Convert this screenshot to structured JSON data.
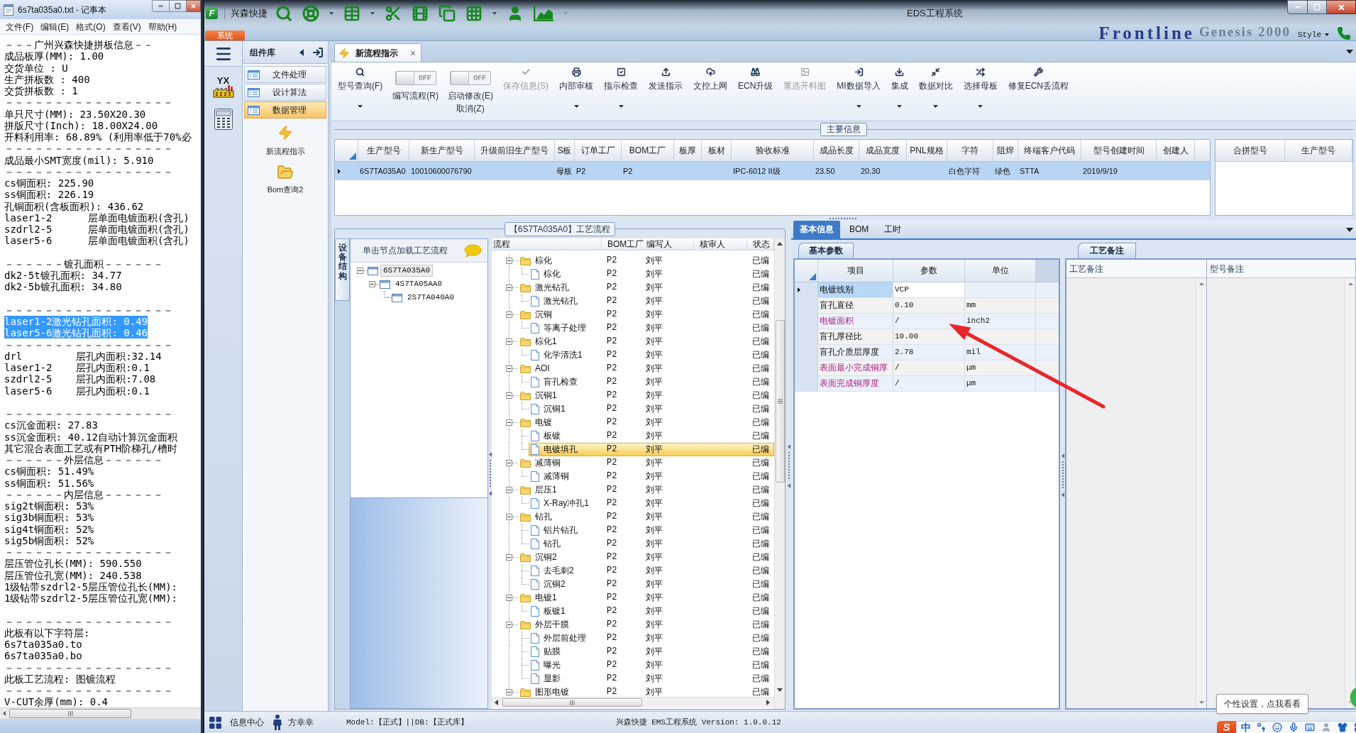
{
  "notepad": {
    "title": "6s7ta035a0.txt - 记事本",
    "menu": [
      "文件(F)",
      "编辑(E)",
      "格式(O)",
      "查看(V)",
      "帮助(H)"
    ],
    "lines": [
      {
        "kind": "text",
        "text": "－－－广州兴森快捷拼板信息－－",
        "selected": false
      },
      {
        "kind": "text",
        "text": "成品板厚(MM): 1.00",
        "selected": false
      },
      {
        "kind": "text",
        "text": "交货单位 : U",
        "selected": false
      },
      {
        "kind": "text",
        "text": "生产拼板数 : 400",
        "selected": false
      },
      {
        "kind": "text",
        "text": "交货拼板数 : 1",
        "selected": false
      },
      {
        "kind": "text",
        "text": "－－－－－－－－－－－－－－－－－",
        "selected": false
      },
      {
        "kind": "text",
        "text": "单只尺寸(MM): 23.50X20.30",
        "selected": false
      },
      {
        "kind": "text",
        "text": "拼版尺寸(Inch): 18.00X24.00",
        "selected": false
      },
      {
        "kind": "text",
        "text": "开料利用率: 68.89% (利用率低于70%必",
        "selected": false
      },
      {
        "kind": "text",
        "text": "－－－－－－－－－－－－－－－－－",
        "selected": false
      },
      {
        "kind": "text",
        "text": "成品最小SMT宽度(mil): 5.910",
        "selected": false
      },
      {
        "kind": "text",
        "text": "－－－－－－－－－－－－－－－－－",
        "selected": false
      },
      {
        "kind": "text",
        "text": "cs铜面积: 225.90",
        "selected": false
      },
      {
        "kind": "text",
        "text": "ss铜面积: 226.19",
        "selected": false
      },
      {
        "kind": "text",
        "text": "孔铜面积(含板面积): 436.62",
        "selected": false
      },
      {
        "kind": "text",
        "text": "laser1-2      层单面电镀面积(含孔)",
        "selected": false
      },
      {
        "kind": "text",
        "text": "szdrl2-5      层单面电镀面积(含孔)",
        "selected": false
      },
      {
        "kind": "text",
        "text": "laser5-6      层单面电镀面积(含孔)",
        "selected": false
      },
      {
        "kind": "blank"
      },
      {
        "kind": "text",
        "text": "－－－－－－镀孔面积－－－－－－",
        "selected": false
      },
      {
        "kind": "text",
        "text": "dk2-5t镀孔面积: 34.77",
        "selected": false
      },
      {
        "kind": "text",
        "text": "dk2-5b镀孔面积: 34.80",
        "selected": false
      },
      {
        "kind": "blank"
      },
      {
        "kind": "text",
        "text": "－－－－－－－－－－－－－－－－－",
        "selected": false
      },
      {
        "kind": "text",
        "text": "laser1-2激光钻孔面积: 0.49",
        "selected": true
      },
      {
        "kind": "text",
        "text": "laser5-6激光钻孔面积: 0.46",
        "selected": true
      },
      {
        "kind": "text",
        "text": "－－－－－－－－－－－－－－－－－",
        "selected": false
      },
      {
        "kind": "text",
        "text": "drl         层孔内面积:32.14",
        "selected": false
      },
      {
        "kind": "text",
        "text": "laser1-2    层孔内面积:0.1",
        "selected": false
      },
      {
        "kind": "text",
        "text": "szdrl2-5    层孔内面积:7.08",
        "selected": false
      },
      {
        "kind": "text",
        "text": "laser5-6    层孔内面积:0.1",
        "selected": false
      },
      {
        "kind": "blank"
      },
      {
        "kind": "text",
        "text": "－－－－－－－－－－－－－－－－－",
        "selected": false
      },
      {
        "kind": "text",
        "text": "cs沉金面积: 27.83",
        "selected": false
      },
      {
        "kind": "text",
        "text": "ss沉金面积: 40.12自动计算沉金面积",
        "selected": false
      },
      {
        "kind": "text",
        "text": "其它混合表面工艺或有PTH阶梯孔/槽时",
        "selected": false
      },
      {
        "kind": "text",
        "text": "－－－－－－外层信息－－－－－－",
        "selected": false
      },
      {
        "kind": "text",
        "text": "cs铜面积: 51.49%",
        "selected": false
      },
      {
        "kind": "text",
        "text": "ss铜面积: 51.56%",
        "selected": false
      },
      {
        "kind": "text",
        "text": "－－－－－－内层信息－－－－－－",
        "selected": false
      },
      {
        "kind": "text",
        "text": "sig2t铜面积: 53%",
        "selected": false
      },
      {
        "kind": "text",
        "text": "sig3b铜面积: 53%",
        "selected": false
      },
      {
        "kind": "text",
        "text": "sig4t铜面积: 52%",
        "selected": false
      },
      {
        "kind": "text",
        "text": "sig5b铜面积: 52%",
        "selected": false
      },
      {
        "kind": "text",
        "text": "－－－－－－－－－－－－－－－－－",
        "selected": false
      },
      {
        "kind": "text",
        "text": "层压管位孔长(MM): 590.550",
        "selected": false
      },
      {
        "kind": "text",
        "text": "层压管位孔宽(MM): 240.538",
        "selected": false
      },
      {
        "kind": "text",
        "text": "1级钻带szdrl2-5层压管位孔长(MM):",
        "selected": false
      },
      {
        "kind": "text",
        "text": "1级钻带szdrl2-5层压管位孔宽(MM):",
        "selected": false
      },
      {
        "kind": "blank"
      },
      {
        "kind": "text",
        "text": "－－－－－－－－－－－－－－－－－",
        "selected": false
      },
      {
        "kind": "text",
        "text": "此板有以下字符层:",
        "selected": false
      },
      {
        "kind": "text",
        "text": "6s7ta035a0.to",
        "selected": false
      },
      {
        "kind": "text",
        "text": "6s7ta035a0.bo",
        "selected": false
      },
      {
        "kind": "text",
        "text": "－－－－－－－－－－－－－－－－－",
        "selected": false
      },
      {
        "kind": "text",
        "text": "此板工艺流程: 图镀流程",
        "selected": false
      },
      {
        "kind": "text",
        "text": "－－－－－－－－－－－－－－－－－",
        "selected": false
      },
      {
        "kind": "text",
        "text": "V-CUT余厚(mm): 0.4",
        "selected": false
      }
    ]
  },
  "app": {
    "logo": "F",
    "brand": "兴森快捷",
    "title": "EDS工程系统",
    "system_tab": "系统",
    "backdrop": [
      "Frontline",
      "Genesis 2000"
    ],
    "style_menu": "Style"
  },
  "launcher_badge": "YX",
  "components": {
    "title": "组件库",
    "items": [
      {
        "label": "文件处理",
        "selected": false
      },
      {
        "label": "设计算法",
        "selected": false
      },
      {
        "label": "数据管理",
        "selected": true
      }
    ],
    "tools": [
      "新流程指示",
      "Bom查询2"
    ]
  },
  "doc_tabs": [
    {
      "label": "新流程指示",
      "selected": true
    }
  ],
  "ribbon": [
    {
      "kind": "button",
      "lines": [
        "型号查询(F)"
      ],
      "disabled": false,
      "has_menu": true
    },
    {
      "kind": "toggle",
      "toggle_text": "OFF",
      "on": false,
      "lines": [
        "编写流程(R)"
      ],
      "disabled": false
    },
    {
      "kind": "toggle",
      "toggle_text": "OFF",
      "on": false,
      "lines": [
        "启动修改(E)",
        "取消(Z)"
      ],
      "disabled": false
    },
    {
      "kind": "button",
      "lines": [
        "保存信息(S)"
      ],
      "disabled": true,
      "has_menu": false
    },
    {
      "kind": "button",
      "lines": [
        "内部审核"
      ],
      "disabled": false,
      "has_menu": true
    },
    {
      "kind": "button",
      "lines": [
        "指示检查"
      ],
      "disabled": false,
      "has_menu": true
    },
    {
      "kind": "button",
      "lines": [
        "发送指示"
      ],
      "disabled": false,
      "has_menu": false
    },
    {
      "kind": "button",
      "lines": [
        "文控上网"
      ],
      "disabled": false,
      "has_menu": false
    },
    {
      "kind": "button",
      "lines": [
        "ECN升级"
      ],
      "disabled": false,
      "has_menu": false
    },
    {
      "kind": "button",
      "lines": [
        "重选开料图"
      ],
      "disabled": true,
      "has_menu": false
    },
    {
      "kind": "button",
      "lines": [
        "MI数据导入"
      ],
      "disabled": false,
      "has_menu": true
    },
    {
      "kind": "button",
      "lines": [
        "集成"
      ],
      "disabled": false,
      "has_menu": true
    },
    {
      "kind": "button",
      "lines": [
        "数据对比"
      ],
      "disabled": false,
      "has_menu": true
    },
    {
      "kind": "button",
      "lines": [
        "选择母板"
      ],
      "disabled": false,
      "has_menu": true
    },
    {
      "kind": "button",
      "lines": [
        "修复ECN丢流程"
      ],
      "disabled": false,
      "has_menu": false
    }
  ],
  "main_info": {
    "title": "主要信息",
    "columns": [
      "生产型号",
      "新生产型号",
      "升级前旧生产型号",
      "S板",
      "订单工厂",
      "BOM工厂",
      "板厚",
      "板材",
      "验收标准",
      "成品长度",
      "成品宽度",
      "PNL规格",
      "字符",
      "阻焊",
      "终端客户代码",
      "型号创建时间",
      "创建人"
    ],
    "rows": [
      {
        "selected": true,
        "cells": [
          "6S7TA035A0",
          "10010600076790",
          null,
          "母板",
          "P2",
          "P2",
          null,
          null,
          "IPC-6012 II级",
          "23.50",
          "20.30",
          null,
          "白色字符",
          "绿色",
          "STTA",
          "2019/9/19",
          null
        ]
      }
    ],
    "side_columns": [
      "合拼型号",
      "生产型号"
    ]
  },
  "process": {
    "title": "【6S7TA035A0】工艺流程",
    "side_tab": "设备结构",
    "tree_hint": "单击节点加载工艺流程",
    "tree": [
      {
        "label": "6S7TA035A0",
        "selected": true,
        "expanded": true,
        "children": [
          {
            "label": "4S7TA05AA0",
            "selected": false,
            "expanded": true,
            "children": [
              {
                "label": "2S7TA040A0",
                "selected": false
              }
            ]
          }
        ]
      }
    ],
    "columns": [
      "流程",
      "BOM工厂",
      "编写人",
      "核审人",
      "状态"
    ],
    "rows": [
      {
        "kind": "group",
        "name": "棕化",
        "bom_factory": "P2",
        "author": "刘平",
        "status": "已编",
        "selected": false,
        "expanded": true,
        "children": [
          {
            "kind": "step",
            "name": "棕化",
            "bom_factory": "P2",
            "author": "刘平",
            "status": "已编",
            "selected": false
          }
        ]
      },
      {
        "kind": "group",
        "name": "激光钻孔",
        "bom_factory": "P2",
        "author": "刘平",
        "status": "已编",
        "selected": false,
        "expanded": true,
        "children": [
          {
            "kind": "step",
            "name": "激光钻孔",
            "bom_factory": "P2",
            "author": "刘平",
            "status": "已编",
            "selected": false
          }
        ]
      },
      {
        "kind": "group",
        "name": "沉铜",
        "bom_factory": "P2",
        "author": "刘平",
        "status": "已编",
        "selected": false,
        "expanded": true,
        "children": [
          {
            "kind": "step",
            "name": "等离子处理",
            "bom_factory": "P2",
            "author": "刘平",
            "status": "已编",
            "selected": false
          }
        ]
      },
      {
        "kind": "group",
        "name": "棕化1",
        "bom_factory": "P2",
        "author": "刘平",
        "status": "已编",
        "selected": false,
        "expanded": true,
        "children": [
          {
            "kind": "step",
            "name": "化学清洗1",
            "bom_factory": "P2",
            "author": "刘平",
            "status": "已编",
            "selected": false
          }
        ]
      },
      {
        "kind": "group",
        "name": "AOI",
        "bom_factory": "P2",
        "author": "刘平",
        "status": "已编",
        "selected": false,
        "expanded": true,
        "children": [
          {
            "kind": "step",
            "name": "盲孔检查",
            "bom_factory": "P2",
            "author": "刘平",
            "status": "已编",
            "selected": false
          }
        ]
      },
      {
        "kind": "group",
        "name": "沉铜1",
        "bom_factory": "P2",
        "author": "刘平",
        "status": "已编",
        "selected": false,
        "expanded": true,
        "children": [
          {
            "kind": "step",
            "name": "沉铜1",
            "bom_factory": "P2",
            "author": "刘平",
            "status": "已编",
            "selected": false
          }
        ]
      },
      {
        "kind": "group",
        "name": "电镀",
        "bom_factory": "P2",
        "author": "刘平",
        "status": "已编",
        "selected": false,
        "expanded": true,
        "children": [
          {
            "kind": "step",
            "name": "板镀",
            "bom_factory": "P2",
            "author": "刘平",
            "status": "已编",
            "selected": false
          },
          {
            "kind": "step",
            "name": "电镀填孔",
            "bom_factory": "P2",
            "author": "刘平",
            "status": "已编",
            "selected": true
          }
        ]
      },
      {
        "kind": "group",
        "name": "减薄铜",
        "bom_factory": "P2",
        "author": "刘平",
        "status": "已编",
        "selected": false,
        "expanded": true,
        "children": [
          {
            "kind": "step",
            "name": "减薄铜",
            "bom_factory": "P2",
            "author": "刘平",
            "status": "已编",
            "selected": false
          }
        ]
      },
      {
        "kind": "group",
        "name": "层压1",
        "bom_factory": "P2",
        "author": "刘平",
        "status": "已编",
        "selected": false,
        "expanded": true,
        "children": [
          {
            "kind": "step",
            "name": "X-Ray冲孔1",
            "bom_factory": "P2",
            "author": "刘平",
            "status": "已编",
            "selected": false
          }
        ]
      },
      {
        "kind": "group",
        "name": "钻孔",
        "bom_factory": "P2",
        "author": "刘平",
        "status": "已编",
        "selected": false,
        "expanded": true,
        "children": [
          {
            "kind": "step",
            "name": "铝片钻孔",
            "bom_factory": "P2",
            "author": "刘平",
            "status": "已编",
            "selected": false
          },
          {
            "kind": "step",
            "name": "钻孔",
            "bom_factory": "P2",
            "author": "刘平",
            "status": "已编",
            "selected": false
          }
        ]
      },
      {
        "kind": "group",
        "name": "沉铜2",
        "bom_factory": "P2",
        "author": "刘平",
        "status": "已编",
        "selected": false,
        "expanded": true,
        "children": [
          {
            "kind": "step",
            "name": "去毛刺2",
            "bom_factory": "P2",
            "author": "刘平",
            "status": "已编",
            "selected": false
          },
          {
            "kind": "step",
            "name": "沉铜2",
            "bom_factory": "P2",
            "author": "刘平",
            "status": "已编",
            "selected": false
          }
        ]
      },
      {
        "kind": "group",
        "name": "电镀1",
        "bom_factory": "P2",
        "author": "刘平",
        "status": "已编",
        "selected": false,
        "expanded": true,
        "children": [
          {
            "kind": "step",
            "name": "板镀1",
            "bom_factory": "P2",
            "author": "刘平",
            "status": "已编",
            "selected": false
          }
        ]
      },
      {
        "kind": "group",
        "name": "外层干膜",
        "bom_factory": "P2",
        "author": "刘平",
        "status": "已编",
        "selected": false,
        "expanded": true,
        "children": [
          {
            "kind": "step",
            "name": "外层前处理",
            "bom_factory": "P2",
            "author": "刘平",
            "status": "已编",
            "selected": false
          },
          {
            "kind": "step",
            "name": "贴膜",
            "bom_factory": "P2",
            "author": "刘平",
            "status": "已编",
            "selected": false
          },
          {
            "kind": "step",
            "name": "曝光",
            "bom_factory": "P2",
            "author": "刘平",
            "status": "已编",
            "selected": false
          },
          {
            "kind": "step",
            "name": "显影",
            "bom_factory": "P2",
            "author": "刘平",
            "status": "已编",
            "selected": false
          }
        ]
      },
      {
        "kind": "group",
        "name": "图形电镀",
        "bom_factory": "P2",
        "author": "刘平",
        "status": "已编",
        "selected": false,
        "expanded": true
      }
    ]
  },
  "details": {
    "tabs": [
      {
        "label": "基本信息",
        "selected": true
      },
      {
        "label": "BOM",
        "selected": false
      },
      {
        "label": "工时",
        "selected": false
      }
    ],
    "params": {
      "title": "基本参数",
      "columns": [
        "项目",
        "参数",
        "单位"
      ],
      "rows": [
        {
          "item": "电镀线别",
          "value": "VCP",
          "flagged": false,
          "selected": true
        },
        {
          "item": "盲孔直径",
          "value": "0.10",
          "unit": "mm",
          "flagged": false,
          "selected": false
        },
        {
          "item": "电镀面积",
          "value": "/",
          "unit": "inch2",
          "flagged": true,
          "selected": false
        },
        {
          "item": "盲孔厚径比",
          "value": "10.00",
          "flagged": false,
          "selected": false
        },
        {
          "item": "盲孔介质层厚度",
          "value": "2.78",
          "unit": "mil",
          "flagged": false,
          "selected": false
        },
        {
          "item": "表面最小完成铜厚",
          "value": "/",
          "unit": "μm",
          "flagged": true,
          "selected": false
        },
        {
          "item": "表面完成铜厚度",
          "value": "/",
          "unit": "μm",
          "flagged": true,
          "selected": false
        }
      ]
    },
    "notes": {
      "title": "工艺备注",
      "columns": [
        "工艺备注",
        "型号备注"
      ]
    }
  },
  "status_bar": {
    "info_center": "信息中心",
    "user": "方幸幸",
    "model": "Model:【正式】||DB:【正式库】",
    "version": "兴森快捷 EMS工程系统 Version: 1.0.0.12"
  },
  "tooltip": "个性设置，点我看看",
  "ime_bar": {
    "logo": "S",
    "mode": "中"
  }
}
